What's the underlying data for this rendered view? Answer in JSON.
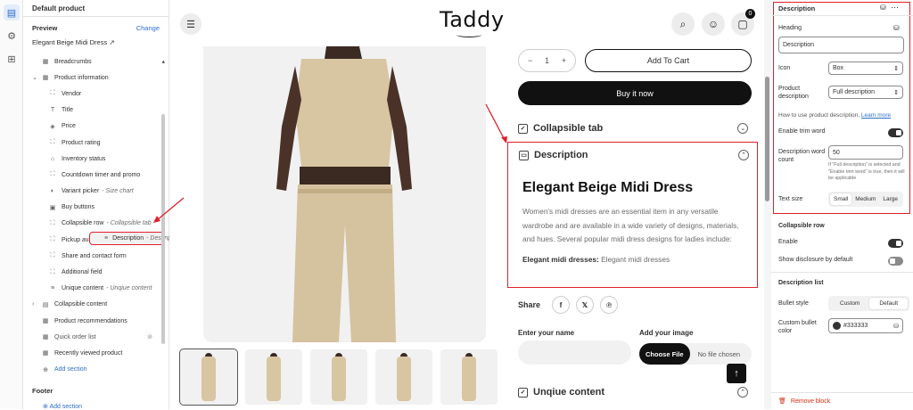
{
  "left_panel": {
    "header": "Default product",
    "preview_label": "Preview",
    "change_label": "Change",
    "product_name": "Elegant Beige Midi Dress",
    "tree": [
      {
        "label": "Breadcrumbs",
        "icon": "layout-icon",
        "glyph": "▦",
        "indent": 1,
        "note": ""
      },
      {
        "label": "Product information",
        "icon": "layout-icon",
        "glyph": "▦",
        "indent": 0,
        "note": "",
        "chevron": "⌄"
      },
      {
        "label": "Vendor",
        "icon": "dashed-box-icon",
        "glyph": "⛶",
        "indent": 2,
        "note": ""
      },
      {
        "label": "Title",
        "icon": "text-icon",
        "glyph": "T",
        "indent": 2,
        "note": ""
      },
      {
        "label": "Price",
        "icon": "tag-icon",
        "glyph": "◈",
        "indent": 2,
        "note": ""
      },
      {
        "label": "Product rating",
        "icon": "dashed-box-icon",
        "glyph": "⛶",
        "indent": 2,
        "note": ""
      },
      {
        "label": "Inventory status",
        "icon": "store-icon",
        "glyph": "⌂",
        "indent": 2,
        "note": ""
      },
      {
        "label": "Countdown timer and promo",
        "icon": "dashed-box-icon",
        "glyph": "⛶",
        "indent": 2,
        "note": ""
      },
      {
        "label": "Variant picker",
        "icon": "variant-icon",
        "glyph": "◐",
        "indent": 2,
        "note": "- Size chart"
      },
      {
        "label": "Buy buttons",
        "icon": "cart-icon",
        "glyph": "▣",
        "indent": 2,
        "note": ""
      },
      {
        "label": "Collapsible row",
        "icon": "dashed-box-icon",
        "glyph": "⛶",
        "indent": 2,
        "note": "- Collapsible tab"
      },
      {
        "label": "Description",
        "icon": "lines-icon",
        "glyph": "≡",
        "indent": 2,
        "note": "- Description",
        "selected": true
      },
      {
        "label": "Pickup availability",
        "icon": "dashed-box-icon",
        "glyph": "⛶",
        "indent": 2,
        "note": ""
      },
      {
        "label": "Share and contact form",
        "icon": "dashed-box-icon",
        "glyph": "⛶",
        "indent": 2,
        "note": ""
      },
      {
        "label": "Additional field",
        "icon": "dashed-box-icon",
        "glyph": "⛶",
        "indent": 2,
        "note": ""
      },
      {
        "label": "Unique content",
        "icon": "lines-icon",
        "glyph": "≡",
        "indent": 2,
        "note": "- Unqiue content"
      },
      {
        "label": "Collapsible content",
        "icon": "collapsible-icon",
        "glyph": "▤",
        "indent": 0,
        "note": "",
        "chevron": "›"
      },
      {
        "label": "Product recommendations",
        "icon": "layout-icon",
        "glyph": "▦",
        "indent": 1,
        "note": ""
      },
      {
        "label": "Quick order list",
        "icon": "layout-icon",
        "glyph": "▦",
        "indent": 1,
        "note": "",
        "muted": true
      },
      {
        "label": "Recently viewed product",
        "icon": "layout-icon",
        "glyph": "▦",
        "indent": 1,
        "note": ""
      },
      {
        "label": "Add section",
        "icon": "plus-circle-icon",
        "glyph": "⊕",
        "indent": 1,
        "note": "",
        "add": true
      }
    ],
    "footer_label": "Footer",
    "footer_add": "Add section"
  },
  "preview": {
    "logo": "Taddy",
    "cart_count": "0",
    "qty_minus": "−",
    "qty_value": "1",
    "qty_plus": "+",
    "add_to_cart": "Add To Cart",
    "buy_now": "Buy it now",
    "collapsible_tab": "Collapsible tab",
    "description_heading": "Description",
    "product_title": "Elegant Beige Midi Dress",
    "description_text": "Women's midi dresses are an essential item in any versatile wardrobe and are available in a wide variety of designs, materials, and hues. Several popular midi dress designs for ladies include:",
    "bold_label": "Elegant midi dresses:",
    "bold_rest": "Elegant midi dresses",
    "share_label": "Share",
    "name_label": "Enter your name",
    "image_label": "Add your image",
    "choose_file": "Choose File",
    "no_file": "No file chosen",
    "unique_content": "Unqiue content"
  },
  "settings": {
    "title": "Description",
    "heading_label": "Heading",
    "heading_value": "Description",
    "icon_label": "Icon",
    "icon_value": "Box",
    "product_desc_label": "Product description",
    "product_desc_value": "Full description",
    "howto_text": "How to use product description,",
    "learn_more": "Learn more",
    "trim_label": "Enable trim word",
    "word_count_label": "Description word count",
    "word_count_value": "50",
    "word_count_help": "If \"Full description\" is selected and \"Enable trim word\" is true, then it will be applicable",
    "text_size_label": "Text size",
    "text_sizes": [
      "Small",
      "Medium",
      "Large"
    ],
    "collapsible_row": "Collapsible row",
    "enable_label": "Enable",
    "show_disclosure_label": "Show disclosure by default",
    "description_list": "Description list",
    "bullet_style_label": "Bullet style",
    "bullet_styles": [
      "Custom",
      "Default"
    ],
    "custom_bullet_label": "Custom bullet color",
    "custom_bullet_value": "#333333",
    "remove_block": "Remove block"
  },
  "colors": {
    "accent": "#2c6ecb",
    "highlight": "#e0202b",
    "bullet": "#333333"
  }
}
